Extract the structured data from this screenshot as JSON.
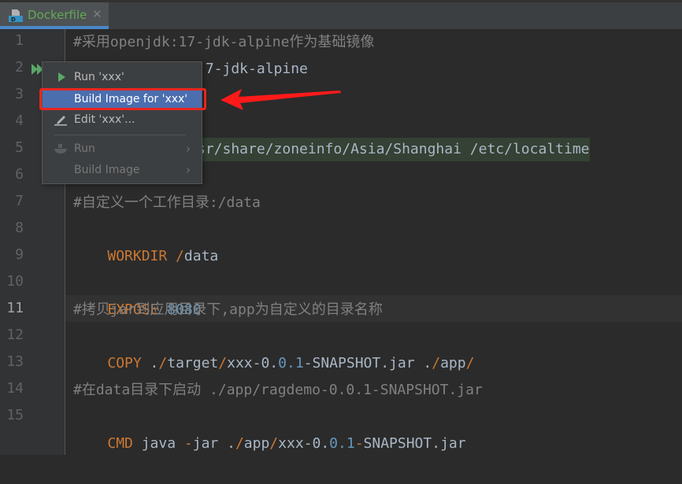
{
  "tabs": [
    {
      "label": "Dockerfile",
      "icon": "docker-file-icon",
      "active": true,
      "close_icon": "close-icon",
      "close_glyph": "✕"
    }
  ],
  "gutter": {
    "line_numbers": [
      "1",
      "2",
      "3",
      "4",
      "5",
      "6",
      "7",
      "8",
      "9",
      "10",
      "11",
      "12",
      "13",
      "14",
      "15"
    ],
    "current_line": 11,
    "run_icon": "run-double-arrow-icon"
  },
  "code": {
    "line1": "#采用openjdk:17-jdk-alpine作为基础镜像",
    "line2_visible": ".7-jdk-alpine",
    "line5_visible": "sr/share/zoneinfo/Asia/Shanghai /etc/localtime",
    "line7": "#自定义一个工作目录:/data",
    "line8": {
      "kw": "WORKDIR",
      "slash": " /",
      "path": "data"
    },
    "line10": {
      "kw": "EXPOSE",
      "num": "8080"
    },
    "line11": "#拷贝jar到应用目录下,app为自定义的目录名称",
    "line12": {
      "kw": "COPY",
      "p1": " .",
      "s1": "/",
      "p2": "target",
      "s2": "/",
      "p3": "xxx-0.",
      "n1": "0.1",
      "p4": "-SNAPSHOT.jar .",
      "s3": "/",
      "p5": "app",
      "s4": "/"
    },
    "line14": "#在data目录下启动 ./app/ragdemo-0.0.1-SNAPSHOT.jar",
    "line15": {
      "kw": "CMD",
      "p1": " java ",
      "k2": "-",
      "p2": "jar .",
      "s1": "/",
      "p3": "app",
      "s2": "/",
      "p4": "xxx-0.",
      "n1": "0.1",
      "k3": "-",
      "p5": "SNAPSHOT.jar"
    }
  },
  "context_menu": {
    "items": [
      {
        "label": "Run 'xxx'",
        "icon": "run-icon",
        "enabled": true,
        "selected": false
      },
      {
        "label": "Build Image for 'xxx'",
        "icon": "",
        "enabled": true,
        "selected": true
      },
      {
        "label": "Edit 'xxx'...",
        "icon": "edit-pencil-icon",
        "enabled": true,
        "selected": false
      },
      {
        "label": "Run",
        "icon": "docker-icon",
        "enabled": false,
        "submenu": true
      },
      {
        "label": "Build Image",
        "icon": "",
        "enabled": false,
        "submenu": true
      }
    ],
    "submenu_glyph": "›"
  },
  "annotation": {
    "highlight_color": "#e8261d",
    "arrow_color": "#ff1a1a"
  },
  "colors": {
    "editor_bg": "#2b2b2b",
    "keyword": "#cc7832",
    "number": "#6897bb",
    "comment": "#808080",
    "selection": "#4b6eaf",
    "tab_label": "#62a856"
  }
}
